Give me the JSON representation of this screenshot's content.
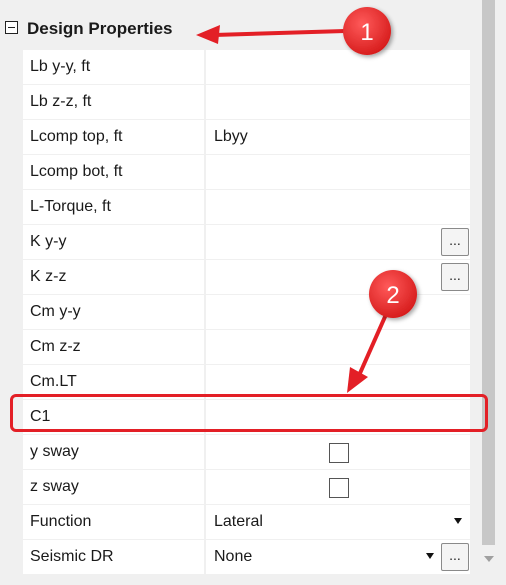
{
  "section": {
    "title": "Design Properties"
  },
  "rows": [
    {
      "label": "Lb y-y, ft",
      "value": ""
    },
    {
      "label": "Lb z-z, ft",
      "value": ""
    },
    {
      "label": "Lcomp top, ft",
      "value": "Lbyy"
    },
    {
      "label": "Lcomp bot, ft",
      "value": ""
    },
    {
      "label": "L-Torque, ft",
      "value": ""
    },
    {
      "label": "K y-y",
      "value": ""
    },
    {
      "label": "K z-z",
      "value": ""
    },
    {
      "label": "Cm y-y",
      "value": ""
    },
    {
      "label": "Cm z-z",
      "value": ""
    },
    {
      "label": "Cm.LT",
      "value": ""
    },
    {
      "label": "C1",
      "value": ""
    },
    {
      "label": "y sway",
      "value": ""
    },
    {
      "label": "z sway",
      "value": ""
    },
    {
      "label": "Function",
      "value": "Lateral"
    },
    {
      "label": "Seismic DR",
      "value": "None"
    }
  ],
  "buttons": {
    "ellipsis": "..."
  },
  "annotations": {
    "badge_1": "1",
    "badge_2": "2",
    "accent_color": "#e31f26"
  }
}
